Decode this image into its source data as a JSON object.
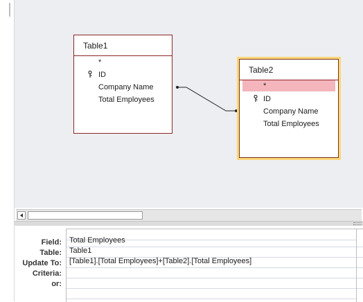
{
  "table1": {
    "title": "Table1",
    "fields": [
      "*",
      "ID",
      "Company Name",
      "Total Employees"
    ]
  },
  "table2": {
    "title": "Table2",
    "fields": [
      "*",
      "ID",
      "Company Name",
      "Total Employees"
    ]
  },
  "grid": {
    "row_labels": [
      "Field:",
      "Table:",
      "Update To:",
      "Criteria:",
      "or:"
    ],
    "column1": {
      "field": "Total Employees",
      "table": "Table1",
      "update_to": "[Table1].[Total Employees]+[Table2].[Total Employees]",
      "criteria": "",
      "or": ""
    }
  },
  "colors": {
    "canvas_bg": "#eceef2",
    "table_border": "#8b2424",
    "selected_table_outline": "#fcd77a",
    "selected_field_bg": "#f4b6bc"
  },
  "icons": {
    "primary_key": "key-icon",
    "scroll_left": "left-arrow-icon"
  }
}
